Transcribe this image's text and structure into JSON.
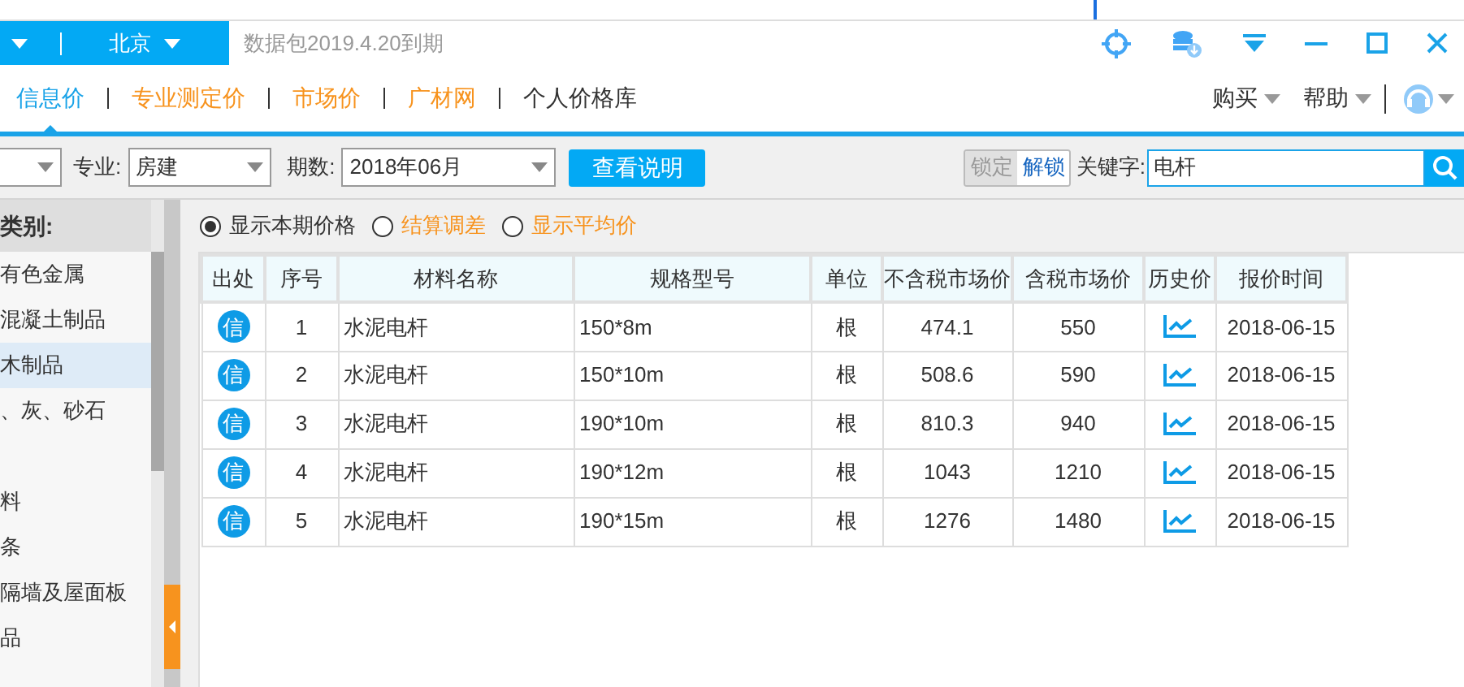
{
  "location": {
    "city": "北京"
  },
  "notice": "数据包2019.4.20到期",
  "nav_tabs": [
    {
      "label": "信息价",
      "selected": true,
      "kind": "blue"
    },
    {
      "label": "专业测定价",
      "selected": false,
      "kind": "orange"
    },
    {
      "label": "市场价",
      "selected": false,
      "kind": "orange"
    },
    {
      "label": "广材网",
      "selected": false,
      "kind": "orange"
    },
    {
      "label": "个人价格库",
      "selected": false,
      "kind": "plain"
    }
  ],
  "nav_menus": [
    "购买",
    "帮助"
  ],
  "filters": {
    "major_label": "专业:",
    "major_value": "房建",
    "period_label": "期数:",
    "period_value": "2018年06月",
    "info_button": "查看说明",
    "lock_button": {
      "label": "锁定",
      "disabled": true
    },
    "unlock_button": {
      "label": "解锁",
      "disabled": false
    },
    "keyword_label": "关键字:",
    "keyword_value": "电杆"
  },
  "sidebar": {
    "title": "类别:",
    "items": [
      {
        "label": "有色金属",
        "selected": false
      },
      {
        "label": "混凝土制品",
        "selected": false
      },
      {
        "label": "木制品",
        "selected": true
      },
      {
        "label": "、灰、砂石",
        "selected": false
      },
      {
        "label": "料",
        "selected": false
      },
      {
        "label": "条",
        "selected": false
      },
      {
        "label": "隔墙及屋面板",
        "selected": false
      },
      {
        "label": "品",
        "selected": false
      }
    ]
  },
  "price_modes": [
    {
      "label": "显示本期价格",
      "selected": true,
      "kind": "plain"
    },
    {
      "label": "结算调差",
      "selected": false,
      "kind": "orange"
    },
    {
      "label": "显示平均价",
      "selected": false,
      "kind": "orange"
    }
  ],
  "table": {
    "columns": [
      "出处",
      "序号",
      "材料名称",
      "规格型号",
      "单位",
      "不含税市场价",
      "含税市场价",
      "历史价",
      "报价时间"
    ],
    "rows": [
      {
        "source": "信",
        "no": "1",
        "name": "水泥电杆",
        "spec": "150*8m",
        "unit": "根",
        "price_ex_tax": "474.1",
        "price_tax": "550",
        "date": "2018-06-15"
      },
      {
        "source": "信",
        "no": "2",
        "name": "水泥电杆",
        "spec": "150*10m",
        "unit": "根",
        "price_ex_tax": "508.6",
        "price_tax": "590",
        "date": "2018-06-15"
      },
      {
        "source": "信",
        "no": "3",
        "name": "水泥电杆",
        "spec": "190*10m",
        "unit": "根",
        "price_ex_tax": "810.3",
        "price_tax": "940",
        "date": "2018-06-15"
      },
      {
        "source": "信",
        "no": "4",
        "name": "水泥电杆",
        "spec": "190*12m",
        "unit": "根",
        "price_ex_tax": "1043",
        "price_tax": "1210",
        "date": "2018-06-15"
      },
      {
        "source": "信",
        "no": "5",
        "name": "水泥电杆",
        "spec": "190*15m",
        "unit": "根",
        "price_ex_tax": "1276",
        "price_tax": "1480",
        "date": "2018-06-15"
      }
    ]
  }
}
